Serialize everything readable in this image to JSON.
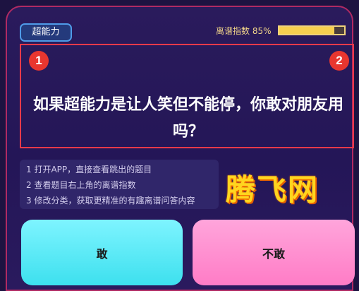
{
  "header": {
    "badge_label": "超能力",
    "score_label": "离谱指数 85%",
    "score_progress": 0.85
  },
  "question": {
    "marker_1": "1",
    "marker_2": "2",
    "text": "如果超能力是让人笑但不能停，你敢对朋友用吗？"
  },
  "steps": {
    "items": [
      "1  打开APP，直接查看跳出的题目",
      "2  查看题目右上角的离谱指数",
      "3  修改分类，获取更精准的有趣离谱问答内容"
    ]
  },
  "watermark": "腾飞网",
  "buttons": {
    "dare_label": "敢",
    "not_dare_label": "不敢"
  }
}
